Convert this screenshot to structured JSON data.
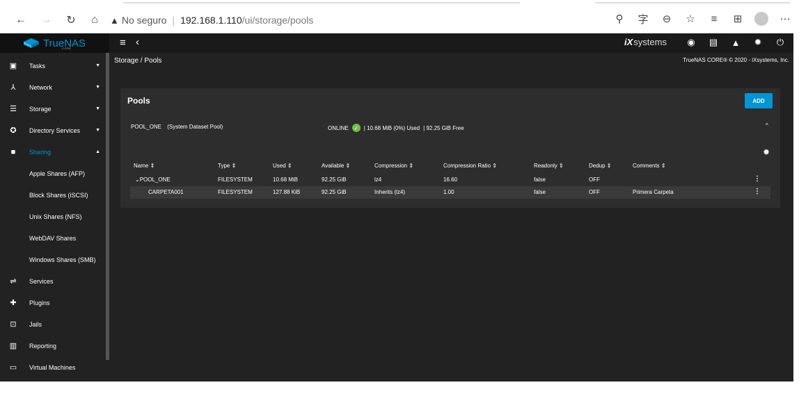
{
  "browser": {
    "security_label": "No seguro",
    "url_host": "192.168.1.110",
    "url_path": "/ui/storage/pools"
  },
  "topbar": {
    "logo_text": "TrueNAS",
    "logo_sub": "CORE",
    "ix_logo": "iX",
    "ix_text": "systems"
  },
  "sidebar": {
    "items": [
      {
        "label": "Tasks",
        "icon": "calendar-icon"
      },
      {
        "label": "Network",
        "icon": "network-icon"
      },
      {
        "label": "Storage",
        "icon": "storage-icon"
      },
      {
        "label": "Directory Services",
        "icon": "directory-icon"
      },
      {
        "label": "Sharing",
        "icon": "folder-share-icon"
      },
      {
        "label": "Services",
        "icon": "services-icon"
      },
      {
        "label": "Plugins",
        "icon": "puzzle-icon"
      },
      {
        "label": "Jails",
        "icon": "jail-icon"
      },
      {
        "label": "Reporting",
        "icon": "chart-icon"
      },
      {
        "label": "Virtual Machines",
        "icon": "monitor-icon"
      }
    ],
    "sharing_sub": [
      "Apple Shares (AFP)",
      "Block Shares (iSCSI)",
      "Unix Shares (NFS)",
      "WebDAV Shares",
      "Windows Shares (SMB)"
    ]
  },
  "page": {
    "breadcrumb": "Storage / Pools",
    "copyright": "TrueNAS CORE® © 2020 - iXsystems, Inc."
  },
  "pools": {
    "title": "Pools",
    "add_label": "ADD",
    "pool_name": "POOL_ONE",
    "pool_tag": "(System Dataset Pool)",
    "status": "ONLINE",
    "usage": "| 10.68 MiB (0%) Used",
    "free": "| 92.25 GiB Free",
    "columns": [
      "Name ⇕",
      "Type ⇕",
      "Used ⇕",
      "Available ⇕",
      "Compression ⇕",
      "Compression Ratio ⇕",
      "Readonly ⇕",
      "Dedup ⇕",
      "Comments ⇕"
    ],
    "rows": [
      [
        "⌄POOL_ONE",
        "FILESYSTEM",
        "10.68 MiB",
        "92.25 GiB",
        "lz4",
        "16.60",
        "false",
        "OFF",
        ""
      ],
      [
        "CARPETA001",
        "FILESYSTEM",
        "127.88 KiB",
        "92.25 GiB",
        "Inherits (lz4)",
        "1.00",
        "false",
        "OFF",
        "Primera Carpeta"
      ]
    ]
  },
  "colors": {
    "accent": "#0095d5",
    "status_ok": "#71bf44",
    "background": "#222222",
    "card": "#2d2d2d"
  }
}
